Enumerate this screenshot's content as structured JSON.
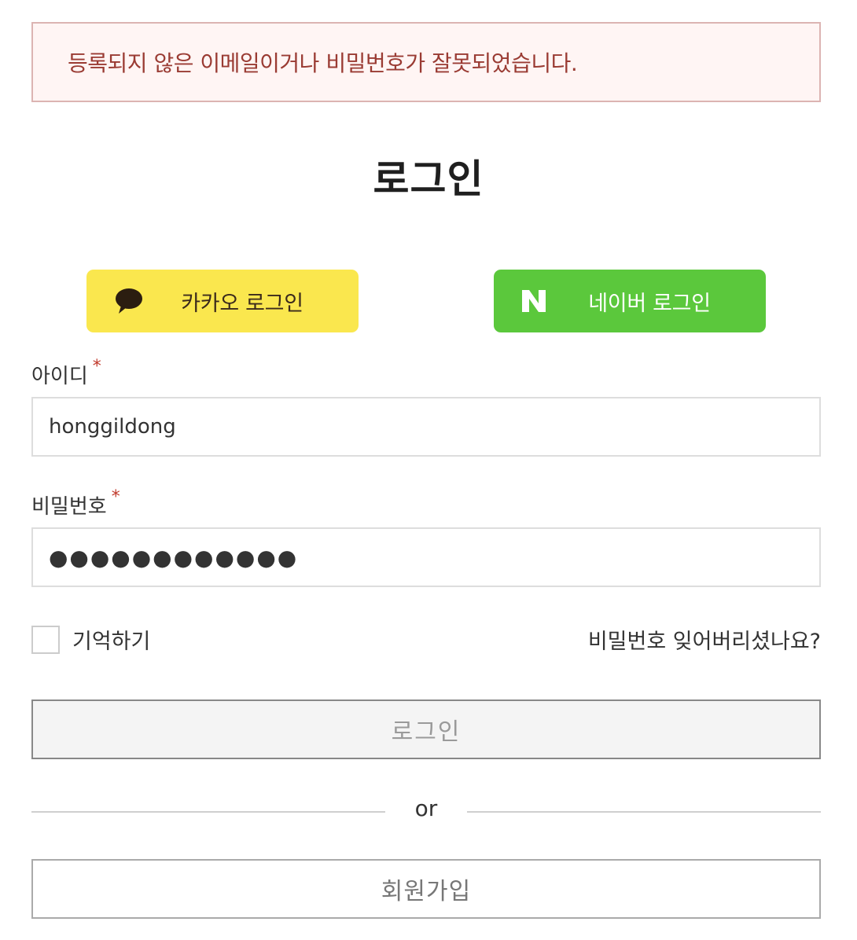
{
  "alert": {
    "message": "등록되지 않은 이메일이거나 비밀번호가 잘못되었습니다."
  },
  "page": {
    "title": "로그인"
  },
  "social": {
    "kakao": {
      "label": "카카오 로그인",
      "icon": "speech-bubble-icon",
      "color": "#fae74e"
    },
    "naver": {
      "label": "네이버 로그인",
      "icon": "naver-n-icon",
      "color": "#5bc83c"
    }
  },
  "form": {
    "id": {
      "label": "아이디",
      "required_mark": "*",
      "value": "honggildong"
    },
    "password": {
      "label": "비밀번호",
      "required_mark": "*",
      "value": "●●●●●●●●●●●●"
    },
    "remember_label": "기억하기",
    "forgot_link": "비밀번호 잊어버리셨나요?",
    "login_button": "로그인",
    "divider_text": "or",
    "signup_button": "회원가입"
  }
}
